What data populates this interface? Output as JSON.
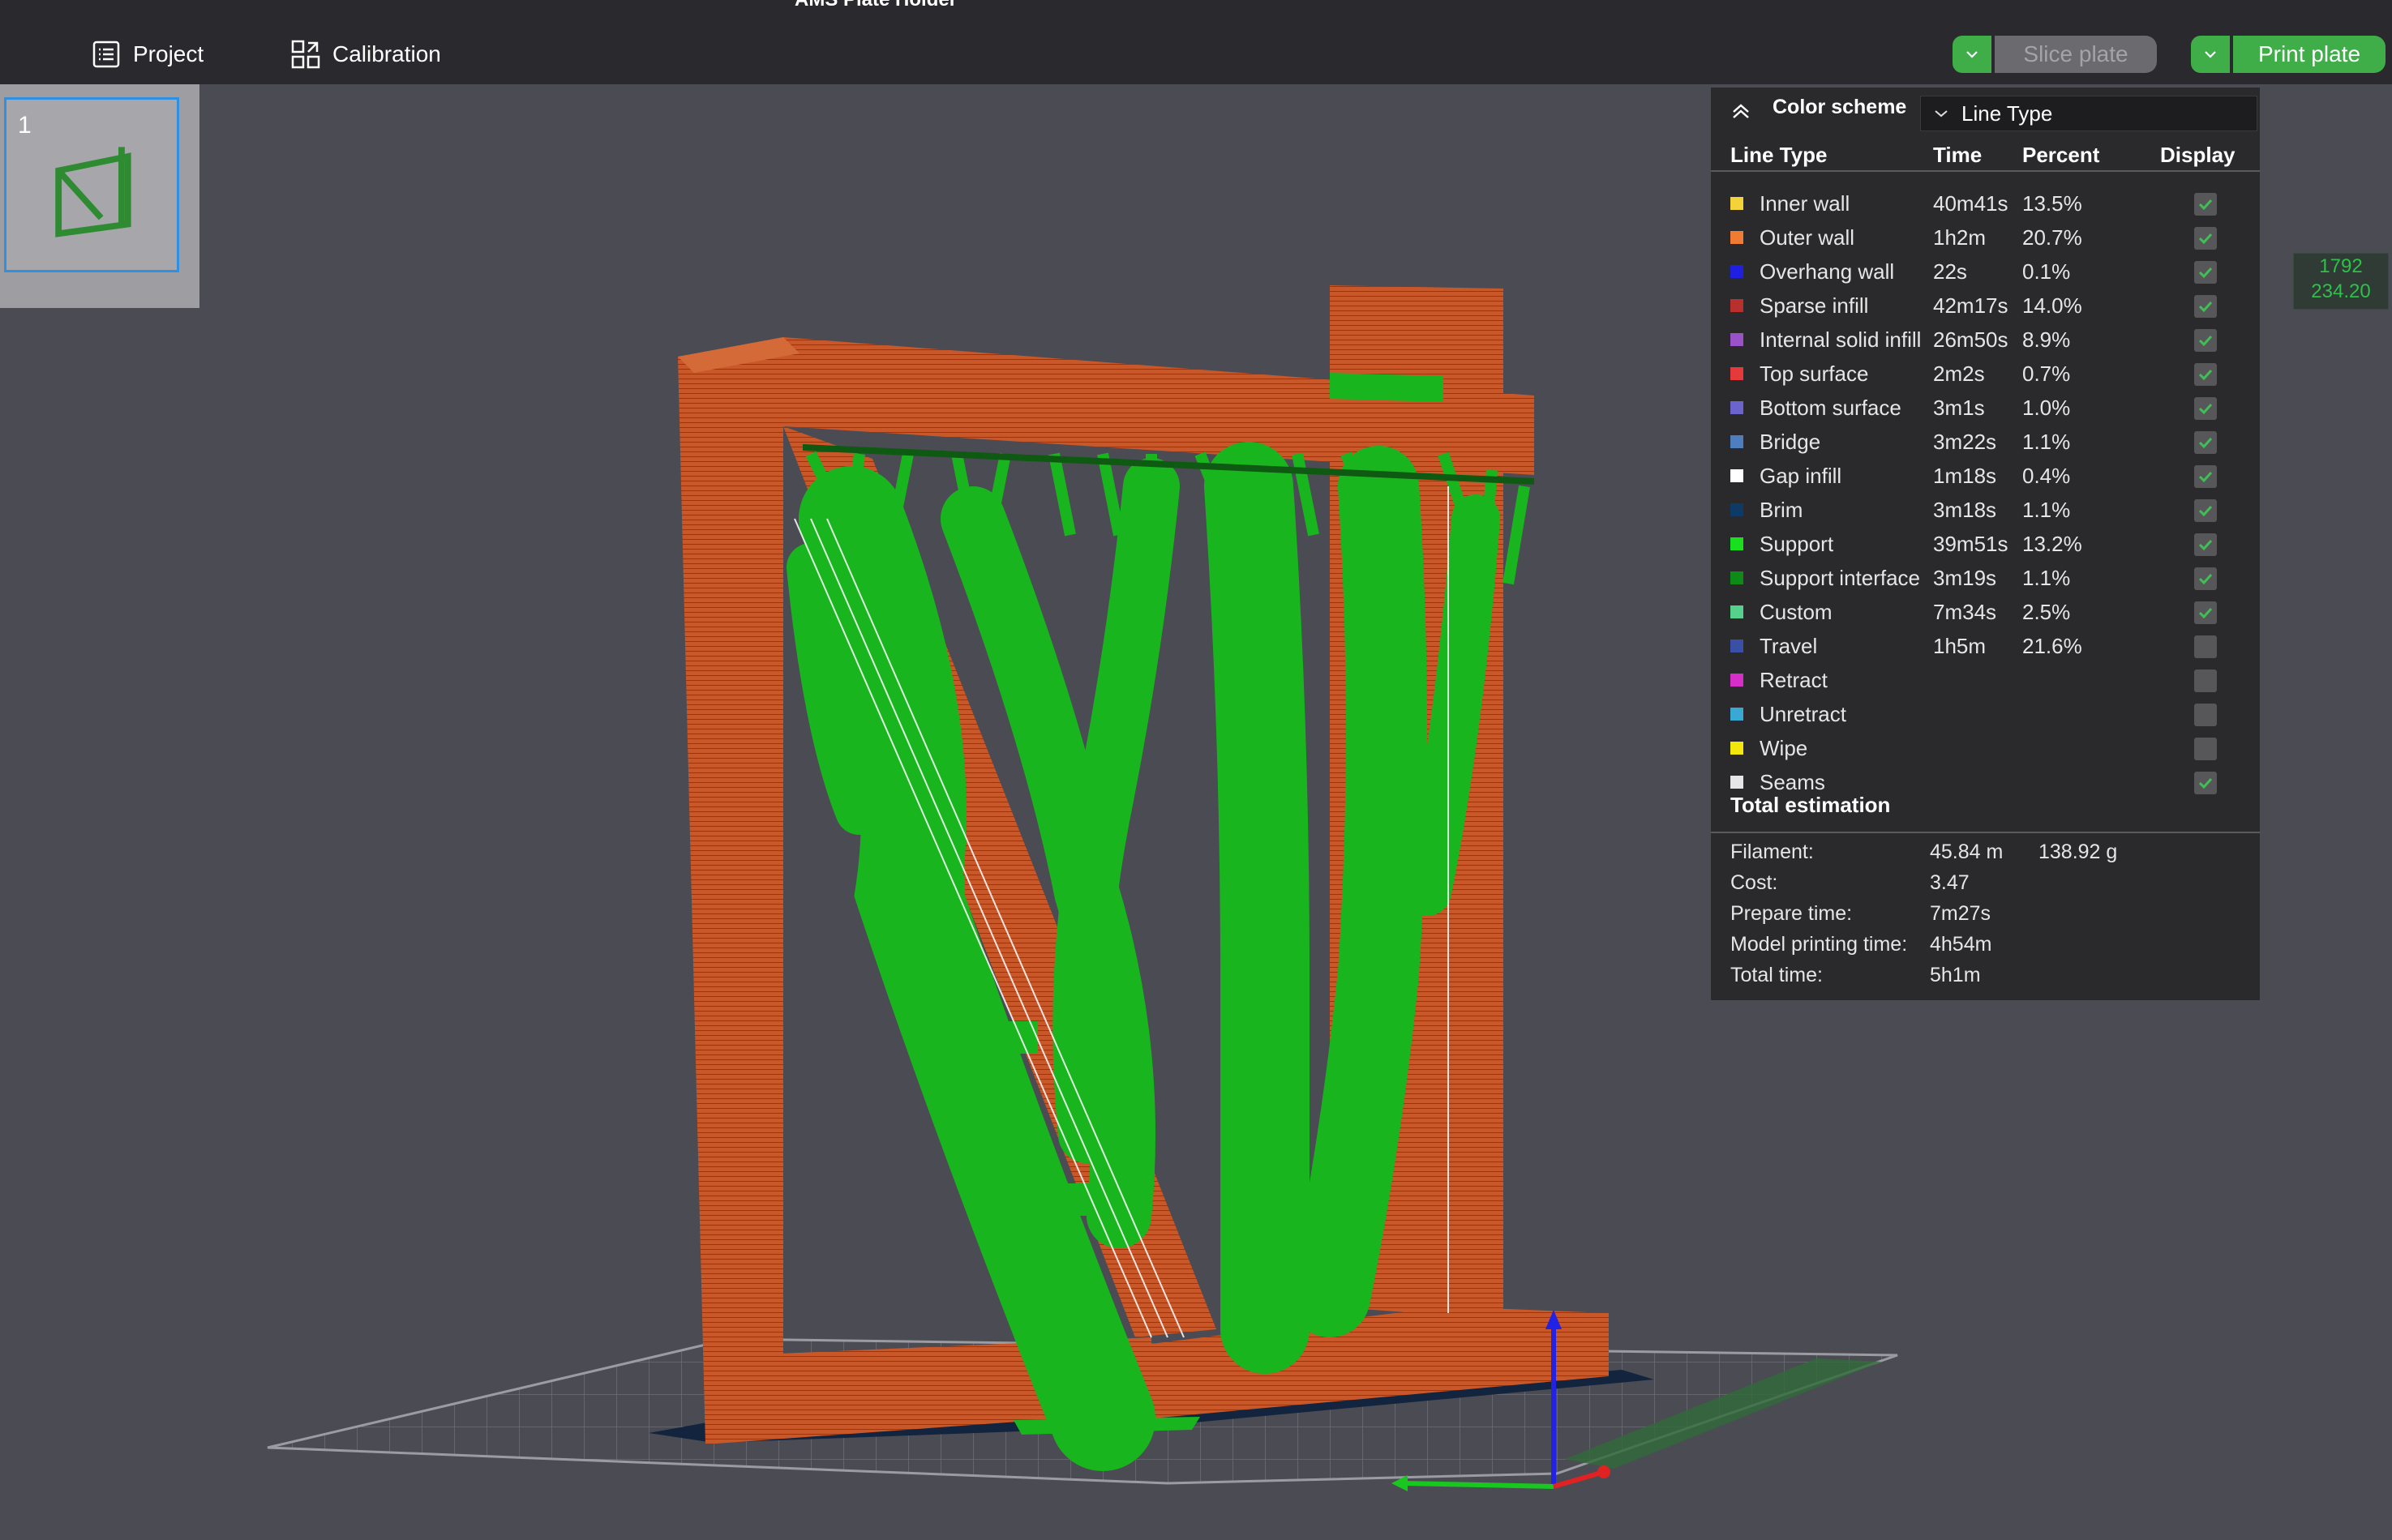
{
  "window": {
    "title": "AMS Plate Holder"
  },
  "topbar": {
    "project_label": "Project",
    "calibration_label": "Calibration",
    "slice_label": "Slice plate",
    "print_label": "Print plate"
  },
  "plates": {
    "current_number": "1"
  },
  "readout": {
    "line1": "1792",
    "line2": "234.20"
  },
  "color_scheme": {
    "title": "Color scheme",
    "selected": "Line Type",
    "headers": {
      "line_type": "Line Type",
      "time": "Time",
      "percent": "Percent",
      "display": "Display"
    },
    "rows": [
      {
        "name": "Inner wall",
        "time": "40m41s",
        "percent": "13.5%",
        "color": "#f4d23a",
        "display": true
      },
      {
        "name": "Outer wall",
        "time": "1h2m",
        "percent": "20.7%",
        "color": "#f07b32",
        "display": true
      },
      {
        "name": "Overhang wall",
        "time": "22s",
        "percent": "0.1%",
        "color": "#1f1fe0",
        "display": true
      },
      {
        "name": "Sparse infill",
        "time": "42m17s",
        "percent": "14.0%",
        "color": "#b8302e",
        "display": true
      },
      {
        "name": "Internal solid infill",
        "time": "26m50s",
        "percent": "8.9%",
        "color": "#9b52c8",
        "display": true
      },
      {
        "name": "Top surface",
        "time": "2m2s",
        "percent": "0.7%",
        "color": "#e8393a",
        "display": true
      },
      {
        "name": "Bottom surface",
        "time": "3m1s",
        "percent": "1.0%",
        "color": "#6a64cc",
        "display": true
      },
      {
        "name": "Bridge",
        "time": "3m22s",
        "percent": "1.1%",
        "color": "#4d7fbf",
        "display": true
      },
      {
        "name": "Gap infill",
        "time": "1m18s",
        "percent": "0.4%",
        "color": "#ffffff",
        "display": true
      },
      {
        "name": "Brim",
        "time": "3m18s",
        "percent": "1.1%",
        "color": "#0d3b66",
        "display": true
      },
      {
        "name": "Support",
        "time": "39m51s",
        "percent": "13.2%",
        "color": "#19e01f",
        "display": true
      },
      {
        "name": "Support interface",
        "time": "3m19s",
        "percent": "1.1%",
        "color": "#0e8a16",
        "display": true
      },
      {
        "name": "Custom",
        "time": "7m34s",
        "percent": "2.5%",
        "color": "#55d18b",
        "display": true
      },
      {
        "name": "Travel",
        "time": "1h5m",
        "percent": "21.6%",
        "color": "#3a4fa6",
        "display": false
      },
      {
        "name": "Retract",
        "time": "",
        "percent": "",
        "color": "#d62fc9",
        "display": false
      },
      {
        "name": "Unretract",
        "time": "",
        "percent": "",
        "color": "#3aa8d4",
        "display": false
      },
      {
        "name": "Wipe",
        "time": "",
        "percent": "",
        "color": "#f2e80b",
        "display": false
      },
      {
        "name": "Seams",
        "time": "",
        "percent": "",
        "color": "#e6e6e6",
        "display": true
      }
    ]
  },
  "estimation": {
    "title": "Total estimation",
    "filament_label": "Filament:",
    "filament_length": "45.84 m",
    "filament_weight": "138.92 g",
    "cost_label": "Cost:",
    "cost": "3.47",
    "prepare_label": "Prepare time:",
    "prepare": "7m27s",
    "model_label": "Model printing time:",
    "model": "4h54m",
    "total_label": "Total time:",
    "total": "5h1m"
  },
  "colors": {
    "accent_green": "#3fae49",
    "model_orange": "#c8582a",
    "support_green": "#19b51f",
    "viewport_bg": "#4b4b53",
    "selection_blue": "#2f8fe0"
  }
}
